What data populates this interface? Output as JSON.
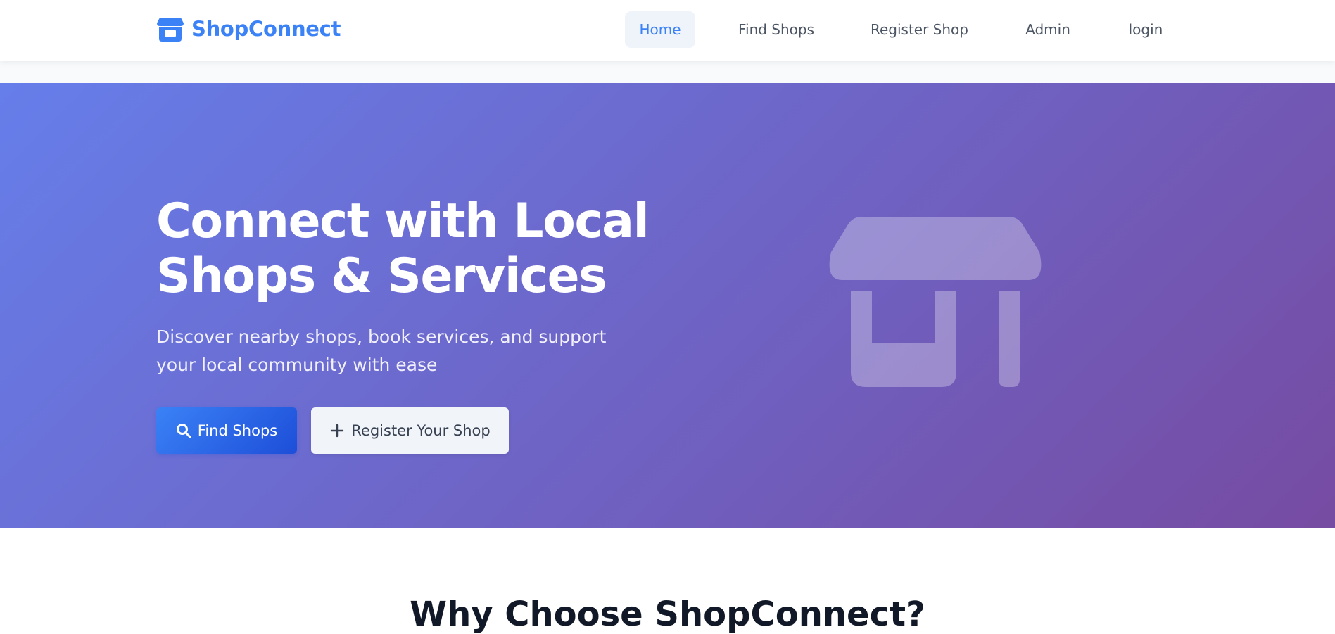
{
  "brand": {
    "name": "ShopConnect",
    "icon": "store-icon",
    "color": "#3b82f6"
  },
  "nav": {
    "items": [
      {
        "label": "Home",
        "active": true
      },
      {
        "label": "Find Shops",
        "active": false
      },
      {
        "label": "Register Shop",
        "active": false
      },
      {
        "label": "Admin",
        "active": false
      },
      {
        "label": "login",
        "active": false
      }
    ]
  },
  "hero": {
    "title": "Connect with Local Shops & Services",
    "subtitle": "Discover nearby shops, book services, and support your local community with ease",
    "primary_button": {
      "label": "Find Shops",
      "icon": "search-icon"
    },
    "secondary_button": {
      "label": "Register Your Shop",
      "icon": "plus-icon"
    },
    "illustration_icon": "store-icon",
    "gradient_start": "#667eea",
    "gradient_end": "#764ba2"
  },
  "section": {
    "heading": "Why Choose ShopConnect?"
  }
}
